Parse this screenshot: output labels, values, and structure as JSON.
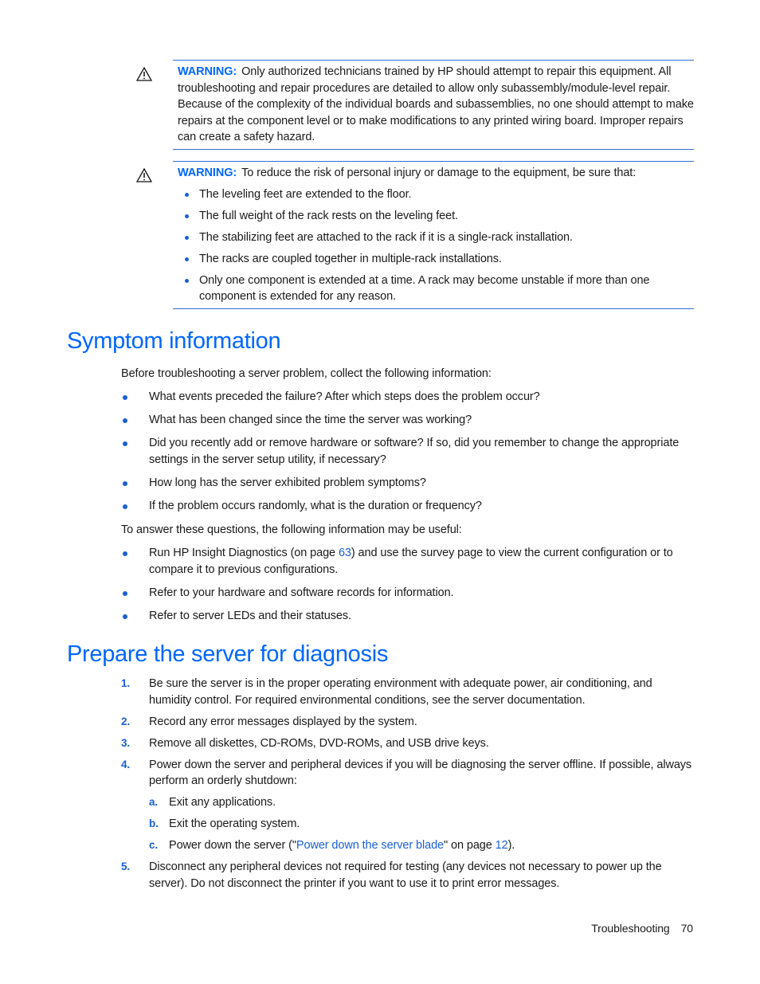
{
  "warnings": [
    {
      "icon": "warning-triangle-icon",
      "label": "WARNING:",
      "text": "Only authorized technicians trained by HP should attempt to repair this equipment. All troubleshooting and repair procedures are detailed to allow only subassembly/module-level repair. Because of the complexity of the individual boards and subassemblies, no one should attempt to make repairs at the component level or to make modifications to any printed wiring board. Improper repairs can create a safety hazard."
    },
    {
      "icon": "warning-triangle-icon",
      "label": "WARNING:",
      "text": "To reduce the risk of personal injury or damage to the equipment, be sure that:",
      "items": [
        "The leveling feet are extended to the floor.",
        "The full weight of the rack rests on the leveling feet.",
        "The stabilizing feet are attached to the rack if it is a single-rack installation.",
        "The racks are coupled together in multiple-rack installations.",
        "Only one component is extended at a time. A rack may become unstable if more than one component is extended for any reason."
      ]
    }
  ],
  "symptom": {
    "title": "Symptom information",
    "intro": "Before troubleshooting a server problem, collect the following information:",
    "questions": [
      "What events preceded the failure? After which steps does the problem occur?",
      "What has been changed since the time the server was working?",
      "Did you recently add or remove hardware or software? If so, did you remember to change the appropriate settings in the server setup utility, if necessary?",
      "How long has the server exhibited problem symptoms?",
      "If the problem occurs randomly, what is the duration or frequency?"
    ],
    "intro2": "To answer these questions, the following information may be useful:",
    "useful": {
      "item1_before": "Run HP Insight Diagnostics (on page ",
      "item1_link": "63",
      "item1_after": ") and use the survey page to view the current configuration or to compare it to previous configurations.",
      "item2": "Refer to your hardware and software records for information.",
      "item3": "Refer to server LEDs and their statuses."
    }
  },
  "prepare": {
    "title": "Prepare the server for diagnosis",
    "steps": [
      {
        "num": "1.",
        "text": "Be sure the server is in the proper operating environment with adequate power, air conditioning, and humidity control. For required environmental conditions, see the server documentation."
      },
      {
        "num": "2.",
        "text": "Record any error messages displayed by the system."
      },
      {
        "num": "3.",
        "text": "Remove all diskettes, CD-ROMs, DVD-ROMs, and USB drive keys."
      },
      {
        "num": "4.",
        "text": "Power down the server and peripheral devices if you will be diagnosing the server offline. If possible, always perform an orderly shutdown:"
      },
      {
        "num": "5.",
        "text": "Disconnect any peripheral devices not required for testing (any devices not necessary to power up the server). Do not disconnect the printer if you want to use it to print error messages."
      }
    ],
    "substeps": {
      "a": {
        "num": "a.",
        "text": "Exit any applications."
      },
      "b": {
        "num": "b.",
        "text": "Exit the operating system."
      },
      "c": {
        "num": "c.",
        "before": "Power down the server (\"",
        "link": "Power down the server blade",
        "middle": "\" on page ",
        "page_link": "12",
        "after": ")."
      }
    }
  },
  "footer": {
    "section": "Troubleshooting",
    "page": "70"
  }
}
